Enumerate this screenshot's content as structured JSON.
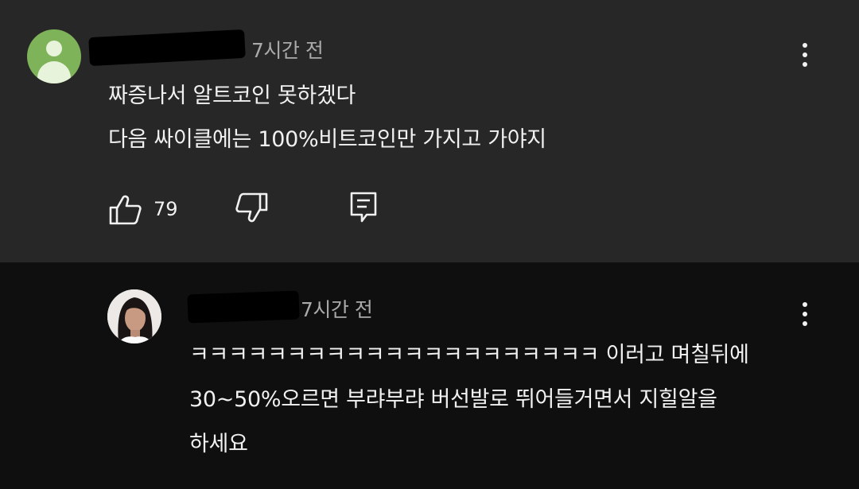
{
  "comment": {
    "time": "7시간 전",
    "lines": [
      "짜증나서 알트코인 못하겠다",
      "다음 싸이클에는 100%비트코인만 가지고 가야지"
    ],
    "like_count": "79",
    "icons": {
      "avatar": "default-user-avatar",
      "like": "thumbs-up-icon",
      "dislike": "thumbs-down-icon",
      "reply": "reply-comment-icon",
      "menu": "more-vert-icon"
    }
  },
  "reply": {
    "time": "7시간 전",
    "lines": [
      "ㅋㅋㅋㅋㅋㅋㅋㅋㅋㅋㅋㅋㅋㅋㅋㅋㅋㅋㅋㅋㅋ 이러고 며칠뒤에",
      "30~50%오르면 부랴부랴 버선발로 뛰어들거면서 지힐알을",
      "하세요"
    ],
    "icons": {
      "avatar": "profile-photo-avatar",
      "menu": "more-vert-icon"
    }
  },
  "colors": {
    "comment_bg": "#272727",
    "reply_bg": "#0f0f0f",
    "text": "#f1f1f1",
    "meta": "#aaaaaa",
    "avatar_green": "#7fb35a"
  }
}
